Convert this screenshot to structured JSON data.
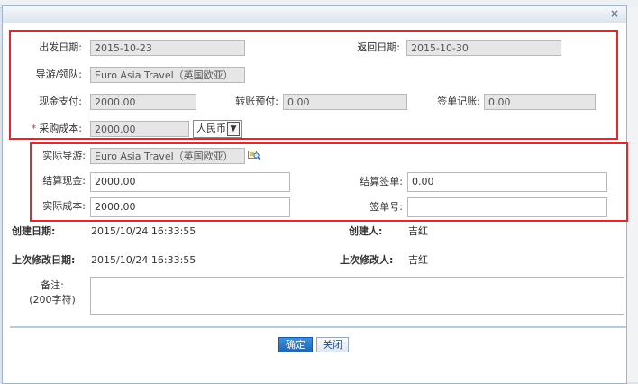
{
  "dialog": {
    "close_glyph": "×",
    "fields": {
      "depart_date": {
        "label": "出发日期:",
        "value": "2015-10-23"
      },
      "return_date": {
        "label": "返回日期:",
        "value": "2015-10-30"
      },
      "guide_leader": {
        "label": "导游/领队:",
        "value": "Euro Asia Travel（英国欧亚）"
      },
      "cash_payment": {
        "label": "现金支付:",
        "value": "2000.00"
      },
      "transfer_prepaid": {
        "label": "转账预付:",
        "value": "0.00"
      },
      "bill_charge": {
        "label": "签单记账:",
        "value": "0.00"
      },
      "purchase_cost": {
        "label": "采购成本:",
        "required_mark": "*",
        "value": "2000.00",
        "currency": "人民币"
      },
      "actual_guide": {
        "label": "实际导游:",
        "value": "Euro Asia Travel（英国欧亚）"
      },
      "settle_cash": {
        "label": "结算现金:",
        "value": "2000.00"
      },
      "settle_bill": {
        "label": "结算签单:",
        "value": "0.00"
      },
      "actual_cost": {
        "label": "实际成本:",
        "value": "2000.00"
      },
      "bill_no": {
        "label": "签单号:",
        "value": ""
      }
    },
    "meta": {
      "created_date": {
        "label": "创建日期:",
        "value": "2015/10/24 16:33:55"
      },
      "creator": {
        "label": "创建人:",
        "value": "吉红"
      },
      "modified_date": {
        "label": "上次修改日期:",
        "value": "2015/10/24 16:33:55"
      },
      "modifier": {
        "label": "上次修改人:",
        "value": "吉红"
      }
    },
    "remark": {
      "label_line1": "备注:",
      "label_line2": "(200字符)",
      "value": ""
    },
    "buttons": {
      "confirm": "确定",
      "close": "关闭"
    }
  },
  "colors": {
    "highlight_box": "#e0282e",
    "primary_button": "#1d68b8"
  },
  "icons": {
    "pick_guide": "lookup-icon",
    "close": "close-icon"
  }
}
